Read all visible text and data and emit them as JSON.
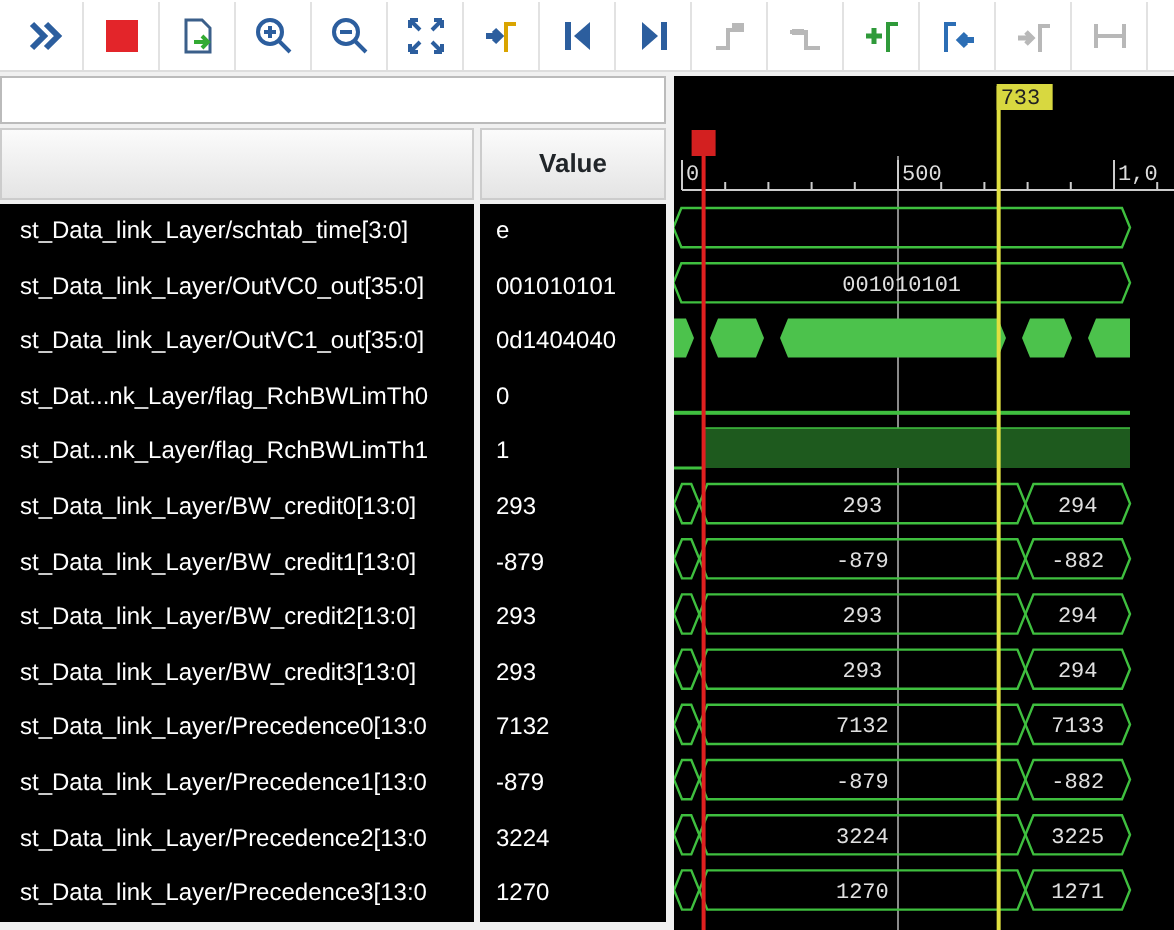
{
  "toolbar": [
    {
      "kind": "expand",
      "disabled": false
    },
    {
      "kind": "stop",
      "disabled": false
    },
    {
      "kind": "export",
      "disabled": false
    },
    {
      "kind": "zoom-in",
      "disabled": false
    },
    {
      "kind": "zoom-out",
      "disabled": false
    },
    {
      "kind": "zoom-fit",
      "disabled": false
    },
    {
      "kind": "go-cursor",
      "disabled": false
    },
    {
      "kind": "go-start",
      "disabled": false
    },
    {
      "kind": "go-end",
      "disabled": false
    },
    {
      "kind": "prev-transition",
      "disabled": true
    },
    {
      "kind": "next-transition",
      "disabled": true
    },
    {
      "kind": "add-marker",
      "disabled": false
    },
    {
      "kind": "prev-marker",
      "disabled": false
    },
    {
      "kind": "next-marker",
      "disabled": true
    },
    {
      "kind": "swap",
      "disabled": true
    }
  ],
  "columns": {
    "value": "Value"
  },
  "timeline": {
    "ticks": [
      "0",
      "500",
      "1,0"
    ],
    "cursor": "733"
  },
  "signals": [
    {
      "name": "st_Data_link_Layer/schtab_time[3:0]",
      "value": "e",
      "wave": {
        "kind": "bus"
      }
    },
    {
      "name": "st_Data_link_Layer/OutVC0_out[35:0]",
      "value": "001010101",
      "wave": {
        "kind": "bus",
        "labels": [
          "001010101"
        ]
      }
    },
    {
      "name": "st_Data_link_Layer/OutVC1_out[35:0]",
      "value": "0d1404040",
      "wave": {
        "kind": "dense"
      }
    },
    {
      "name": "st_Dat...nk_Layer/flag_RchBWLimTh0",
      "value": "0",
      "wave": {
        "kind": "bit",
        "high": false
      }
    },
    {
      "name": "st_Dat...nk_Layer/flag_RchBWLimTh1",
      "value": "1",
      "wave": {
        "kind": "bit",
        "high": true
      }
    },
    {
      "name": "st_Data_link_Layer/BW_credit0[13:0]",
      "value": "293",
      "wave": {
        "kind": "bus",
        "labels": [
          "293",
          "294"
        ]
      }
    },
    {
      "name": "st_Data_link_Layer/BW_credit1[13:0]",
      "value": "-879",
      "wave": {
        "kind": "bus",
        "labels": [
          "-879",
          "-882"
        ]
      }
    },
    {
      "name": "st_Data_link_Layer/BW_credit2[13:0]",
      "value": "293",
      "wave": {
        "kind": "bus",
        "labels": [
          "293",
          "294"
        ]
      }
    },
    {
      "name": "st_Data_link_Layer/BW_credit3[13:0]",
      "value": "293",
      "wave": {
        "kind": "bus",
        "labels": [
          "293",
          "294"
        ]
      }
    },
    {
      "name": "st_Data_link_Layer/Precedence0[13:0",
      "value": "7132",
      "wave": {
        "kind": "bus",
        "labels": [
          "7132",
          "7133"
        ]
      }
    },
    {
      "name": "st_Data_link_Layer/Precedence1[13:0",
      "value": "-879",
      "wave": {
        "kind": "bus",
        "labels": [
          "-879",
          "-882"
        ]
      }
    },
    {
      "name": "st_Data_link_Layer/Precedence2[13:0",
      "value": "3224",
      "wave": {
        "kind": "bus",
        "labels": [
          "3224",
          "3225"
        ]
      }
    },
    {
      "name": "st_Data_link_Layer/Precedence3[13:0",
      "value": "1270",
      "wave": {
        "kind": "bus",
        "labels": [
          "1270",
          "1271"
        ]
      }
    }
  ]
}
